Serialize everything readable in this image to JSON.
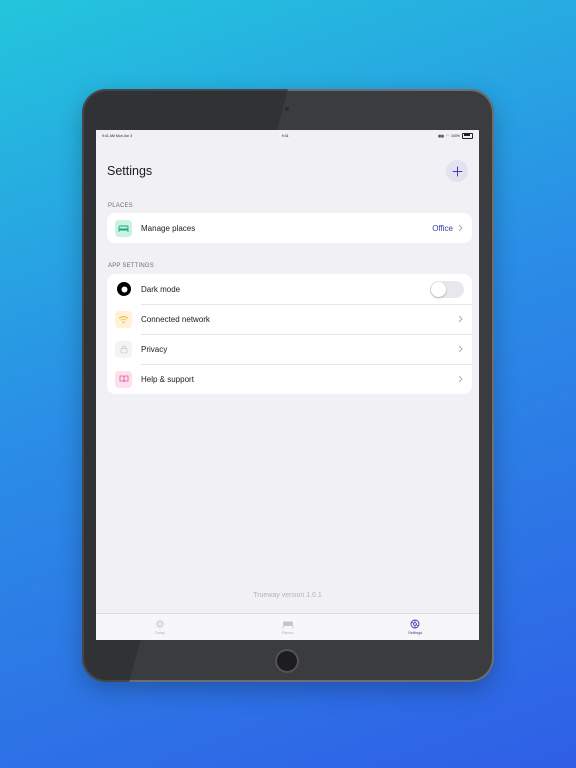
{
  "status_bar": {
    "time_left": "9:41 AM",
    "date": "Mon Jun 3",
    "time_center": "9:41",
    "battery": "100%"
  },
  "header": {
    "title": "Settings",
    "add_icon": "plus-icon"
  },
  "places_section": {
    "label": "PLACES",
    "rows": [
      {
        "label": "Manage places",
        "value": "Office",
        "icon": "bed-icon",
        "icon_bg": "#c9f2e3",
        "icon_color": "#1aa77a"
      }
    ]
  },
  "app_settings_section": {
    "label": "APP SETTINGS",
    "rows": [
      {
        "label": "Dark mode",
        "icon": "moon-icon",
        "icon_bg": "#000000",
        "control": "toggle",
        "toggle_on": false
      },
      {
        "label": "Connected network",
        "icon": "wifi-icon",
        "icon_bg": "#fff2d6",
        "icon_color": "#f0b740"
      },
      {
        "label": "Privacy",
        "icon": "lock-icon",
        "icon_bg": "#f4f4f6",
        "icon_color": "#c7c7cc"
      },
      {
        "label": "Help & support",
        "icon": "book-icon",
        "icon_bg": "#fde0ee",
        "icon_color": "#e0559b"
      }
    ]
  },
  "footer": {
    "version": "Trueway version 1.0.1"
  },
  "tab_bar": {
    "tabs": [
      {
        "label": "Today",
        "icon": "sun-icon",
        "active": false
      },
      {
        "label": "Places",
        "icon": "bed-icon",
        "active": false
      },
      {
        "label": "Settings",
        "icon": "gear-icon",
        "active": true
      }
    ]
  },
  "colors": {
    "accent": "#3a3aa8",
    "background": "#f0f0f5"
  }
}
